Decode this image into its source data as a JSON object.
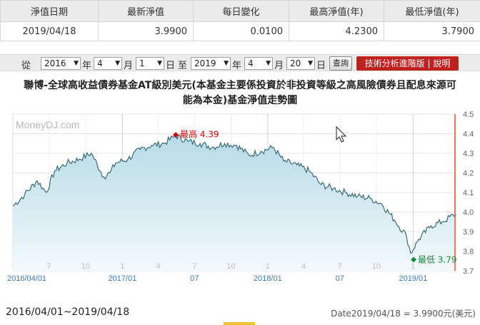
{
  "nav_table": {
    "headers": [
      "淨值日期",
      "最新淨值",
      "每日變化",
      "最高淨值(年)",
      "最低淨值(年)"
    ],
    "row": [
      "2019/04/18",
      "3.9900",
      "0.0100",
      "4.2300",
      "3.7900"
    ]
  },
  "range": {
    "from_label": "從",
    "year_unit": "年",
    "month_unit": "月",
    "day_unit": "日",
    "to_label": "至",
    "start_year": "2016",
    "start_month": "4",
    "start_day": "1",
    "end_year": "2019",
    "end_month": "4",
    "end_day": "20",
    "query_button": "查詢",
    "tech_button": "技術分析進階版 | 說明"
  },
  "fund": {
    "title_line1": "聯博-全球高收益債券基金AT級別美元(本基金主要係投資於非投資等級之高風險債券且配息來源可",
    "title_line2": "能為本金)基金淨值走勢圖"
  },
  "chart_data": {
    "type": "area",
    "watermark": "MoneyDJ.com",
    "ylim": [
      3.7,
      4.5
    ],
    "y_ticks": [
      "4.5",
      "4.4",
      "4.3",
      "4.2",
      "4.1",
      "4.0",
      "3.9",
      "3.8",
      "3.7"
    ],
    "x_month_labels": [
      "7",
      "10",
      "1",
      "4",
      "7",
      "10",
      "1",
      "4",
      "7",
      "10",
      "1"
    ],
    "x_major_labels": [
      "2016/04/01",
      "2017/01",
      "07",
      "2018/01",
      "07",
      "2019/01"
    ],
    "series": [
      {
        "x": [
          "2016/04/01",
          "2016/05/01",
          "2016/06/01",
          "2016/06/24",
          "2016/07/15",
          "2016/08/15",
          "2016/09/15",
          "2016/10/15",
          "2016/11/15",
          "2016/12/01",
          "2016/12/15",
          "2017/01/15",
          "2017/02/15",
          "2017/03/15",
          "2017/04/15",
          "2017/05/15",
          "2017/06/15",
          "2017/07/15",
          "2017/08/15",
          "2017/09/15",
          "2017/10/15",
          "2017/11/15",
          "2017/12/15",
          "2018/01/15",
          "2018/02/10",
          "2018/03/15",
          "2018/04/15",
          "2018/05/15",
          "2018/06/15",
          "2018/07/15",
          "2018/08/15",
          "2018/09/15",
          "2018/10/15",
          "2018/11/15",
          "2018/12/15",
          "2018/12/26",
          "2019/01/15",
          "2019/02/15",
          "2019/03/15",
          "2019/04/18"
        ],
        "values": [
          4.03,
          4.09,
          4.16,
          4.1,
          4.21,
          4.25,
          4.27,
          4.3,
          4.18,
          4.2,
          4.25,
          4.27,
          4.32,
          4.34,
          4.35,
          4.39,
          4.36,
          4.35,
          4.33,
          4.35,
          4.34,
          4.29,
          4.31,
          4.33,
          4.26,
          4.24,
          4.21,
          4.14,
          4.12,
          4.1,
          4.08,
          4.07,
          4.04,
          3.96,
          3.88,
          3.79,
          3.86,
          3.93,
          3.95,
          3.99
        ]
      }
    ],
    "annotations": {
      "high_label": "最高 4.39",
      "low_label": "最低 3.79"
    }
  },
  "footer": {
    "period": "2016/04/01~2019/04/18",
    "latest": "Date2019/04/18 = 3.9900元(美元)"
  },
  "colors": {
    "header_bg": "#ebebeb",
    "tech_button": "#c0201e",
    "line": "#3a6b78",
    "fill_top": "#b7dbe6",
    "high": "#cc0000",
    "low": "#1a8a3a",
    "current_marker": "#e8553c"
  }
}
